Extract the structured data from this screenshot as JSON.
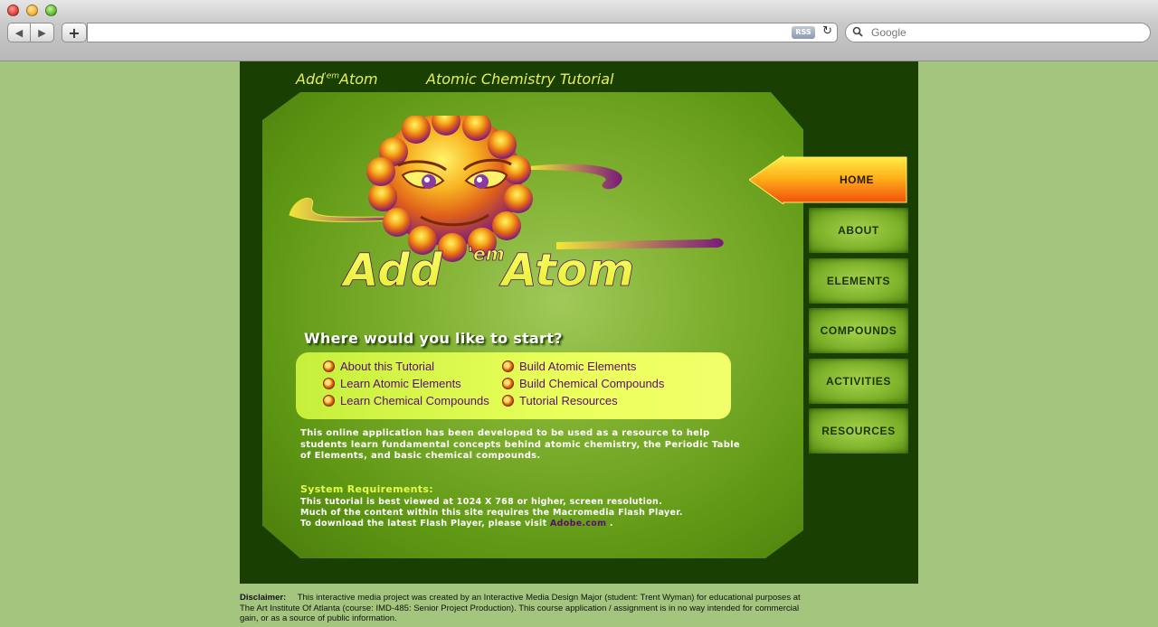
{
  "browser": {
    "rss_label": "RSS",
    "search_placeholder": "Google"
  },
  "site": {
    "brand_small": "Add'em Atom",
    "brand_prefix": "Add",
    "brand_sup": "'em",
    "brand_suffix": "Atom",
    "tagline": "Atomic Chemistry Tutorial",
    "question": "Where would you like to start?",
    "links_left": [
      "About this Tutorial",
      "Learn Atomic Elements",
      "Learn Chemical Compounds"
    ],
    "links_right": [
      "Build Atomic Elements",
      "Build Chemical Compounds",
      "Tutorial Resources"
    ],
    "description": "This online application has been developed to be used as a resource to help students learn fundamental concepts behind atomic chemistry, the Periodic Table of Elements, and basic chemical compounds.",
    "sysreq_title": "System Requirements:",
    "sysreq_line1": "This tutorial is best viewed at 1024 X 768 or higher, screen resolution.",
    "sysreq_line2": "Much of the content within this site requires the Macromedia Flash Player.",
    "sysreq_line3": "To download the latest Flash Player, please visit",
    "sysreq_link": "Adobe.com",
    "sysreq_end": " ."
  },
  "nav": {
    "home": "HOME",
    "items": [
      "ABOUT",
      "ELEMENTS",
      "COMPOUNDS",
      "ACTIVITIES",
      "RESOURCES"
    ]
  },
  "disclaimer": {
    "label": "Disclaimer:",
    "text": "This interactive media project was created by an Interactive Media Design Major (student: Trent Wyman) for educational purposes at The Art Institute Of Atlanta (course: IMD-485: Senior Project Production).  This course application / assignment is in no way intended for commercial gain, or as a source of public information."
  },
  "colors": {
    "page_bg": "#a3c57e",
    "site_bg": "#1a3f02",
    "accent_yellow": "#e6f05a",
    "link_purple": "#5a0e6e"
  }
}
